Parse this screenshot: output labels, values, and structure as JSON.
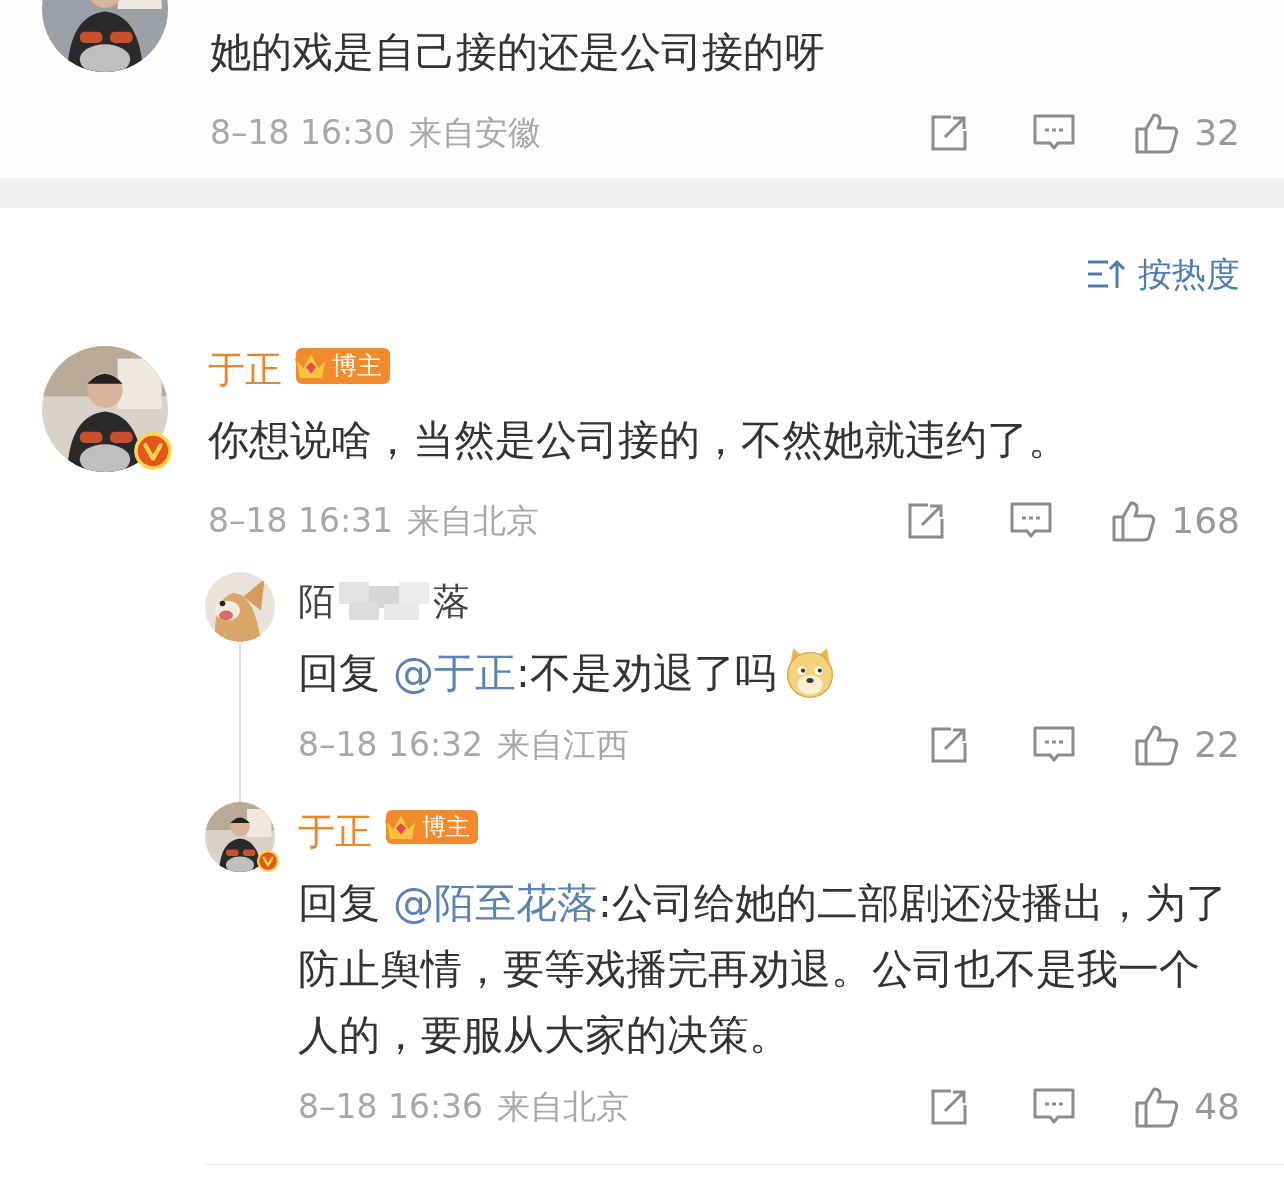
{
  "top_comment": {
    "text": "她的戏是自己接的还是公司接的呀",
    "time": "8–18 16:30",
    "location": "来自安徽",
    "likes": "32"
  },
  "sort_button": {
    "label": "按热度"
  },
  "comment": {
    "name": "于正",
    "badge": "博主",
    "verified": true,
    "text": "你想说啥，当然是公司接的，不然她就违约了。",
    "time": "8–18 16:31",
    "location": "来自北京",
    "likes": "168",
    "replies": [
      {
        "name_start": "陌",
        "name_end": "落",
        "masked": true,
        "verified": false,
        "prefix": "回复",
        "mention": "@于正",
        "text": ":不是劝退了吗",
        "sticker": true,
        "time": "8–18 16:32",
        "location": "来自江西",
        "likes": "22"
      },
      {
        "name": "于正",
        "badge": "博主",
        "verified": true,
        "prefix": "回复",
        "mention": "@陌至花落",
        "text": ":公司给她的二部剧还没播出，为了防止舆情，要等戏播完再劝退。公司也不是我一个人的，要服从大家的决策。",
        "sticker": false,
        "time": "8–18 16:36",
        "location": "来自北京",
        "likes": "48"
      }
    ]
  }
}
